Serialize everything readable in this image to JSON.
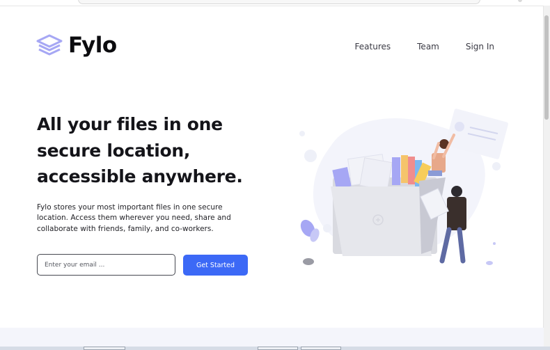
{
  "brand": {
    "name": "Fylo",
    "logo_icon": "layered-stack-icon",
    "accent": "#3c69f6",
    "logo_color": "#a6a7f4"
  },
  "nav": {
    "items": [
      {
        "label": "Features"
      },
      {
        "label": "Team"
      },
      {
        "label": "Sign In"
      }
    ]
  },
  "hero": {
    "title": "All your files in one secure location, accessible anywhere.",
    "description": "Fylo stores your most important files in one secure location. Access them wherever you need, share and collaborate with friends, family, and co-workers.",
    "email_placeholder": "Enter your email ...",
    "cta_label": "Get Started"
  },
  "illustration": {
    "icon": "people-with-files-illustration"
  }
}
